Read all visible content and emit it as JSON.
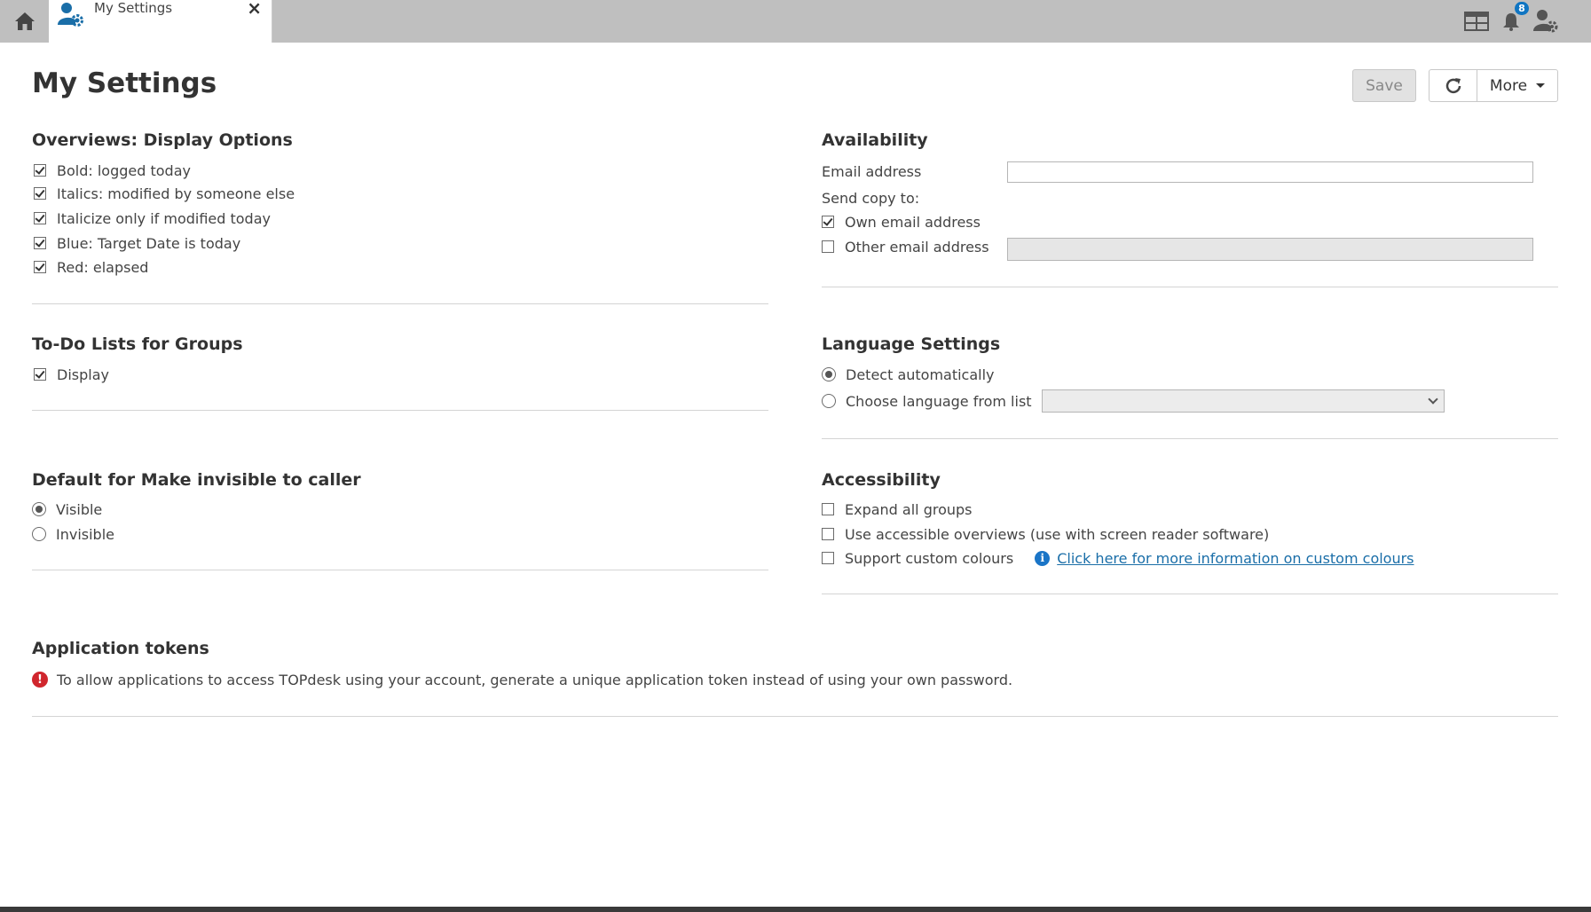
{
  "tab": {
    "label": "My Settings",
    "close": "×"
  },
  "header": {
    "notifications_count": "8"
  },
  "page": {
    "title": "My Settings"
  },
  "toolbar": {
    "save": "Save",
    "more": "More"
  },
  "overviews": {
    "title": "Overviews: Display Options",
    "options": [
      {
        "label": "Bold: logged today",
        "checked": true
      },
      {
        "label": "Italics: modified by someone else",
        "checked": true
      },
      {
        "label": "Italicize only if modified today",
        "checked": true
      },
      {
        "label": "Blue: Target Date is today",
        "checked": true
      },
      {
        "label": "Red: elapsed",
        "checked": true
      }
    ]
  },
  "todo": {
    "title": "To-Do Lists for Groups",
    "display_label": "Display",
    "display_checked": true
  },
  "invisible": {
    "title": "Default for Make invisible to caller",
    "options": [
      {
        "label": "Visible",
        "selected": true
      },
      {
        "label": "Invisible",
        "selected": false
      }
    ]
  },
  "availability": {
    "title": "Availability",
    "email_label": "Email address",
    "email_value": "",
    "send_copy_label": "Send copy to:",
    "own_email_label": "Own email address",
    "own_email_checked": true,
    "other_email_label": "Other email address",
    "other_email_checked": false,
    "other_email_value": ""
  },
  "language": {
    "title": "Language Settings",
    "detect_label": "Detect automatically",
    "detect_selected": true,
    "choose_label": "Choose language from list",
    "choose_selected": false,
    "selected_language": ""
  },
  "accessibility": {
    "title": "Accessibility",
    "expand_groups": "Expand all groups",
    "accessible_overviews": "Use accessible overviews (use with screen reader software)",
    "custom_colours": "Support custom colours",
    "custom_colours_link": "Click here for more information on custom colours"
  },
  "tokens": {
    "title": "Application tokens",
    "message": "To allow applications to access TOPdesk using your account, generate a unique application token instead of using your own password."
  },
  "colors": {
    "topbar": "#bfbfbf",
    "accent": "#1075c2",
    "link": "#1a6ea8",
    "warning": "#d0262d"
  },
  "icons": [
    "home-icon",
    "user-settings-icon",
    "dashboard-icon",
    "bell-icon",
    "user-gear-icon",
    "refresh-icon",
    "info-icon",
    "warning-icon"
  ]
}
